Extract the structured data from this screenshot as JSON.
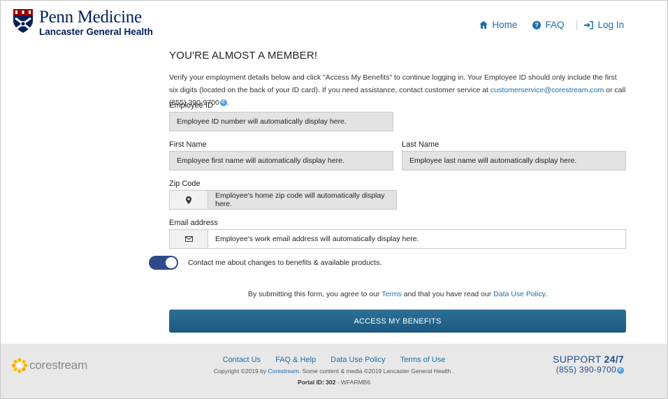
{
  "header": {
    "logo_title": "Penn Medicine",
    "logo_subtitle": "Lancaster General Health",
    "nav": {
      "home": "Home",
      "faq": "FAQ",
      "login": "Log In"
    }
  },
  "main": {
    "title": "YOU'RE ALMOST A MEMBER!",
    "intro_part1": "Verify your employment details below and click \"Access My Benefits\" to continue logging in. Your Employee ID should only include the first six digits (located on the back of your ID card). If you need assistance, contact customer service at ",
    "support_email": "customerservice@corestream.com",
    "intro_part2": " or call (855) 390-9700",
    "intro_end": ".",
    "employee_id": {
      "label": "Employee ID",
      "value": "Employee ID number will automatically display here."
    },
    "first_name": {
      "label": "First Name",
      "value": "Employee first name will automatically display here."
    },
    "last_name": {
      "label": "Last Name",
      "value": "Employee last name will automatically display here."
    },
    "zip": {
      "label": "Zip Code",
      "value": "Employee's home zip code will automatically display here."
    },
    "email": {
      "label": "Email address",
      "value": "Employee's work email address will automatically display here."
    },
    "contact_toggle_label": "Contact me about changes to benefits & available products.",
    "contact_toggle_on": true,
    "terms_part1": "By submitting this form, you agree to our ",
    "terms_link": "Terms",
    "terms_part2": " and that you have read our ",
    "data_use_link": "Data Use Policy",
    "terms_end": ".",
    "submit_label": "ACCESS MY BENEFITS"
  },
  "footer": {
    "logo_text": "corestream",
    "links": [
      "Contact Us",
      "FAQ & Help",
      "Data Use Policy",
      "Terms of Use"
    ],
    "copyright_part1": "Copyright ©2019 by ",
    "copyright_link": "Corestream",
    "copyright_part2": ". Some content & media ©2019 Lancaster General Health .",
    "portal_label": "Portal ID: 302",
    "portal_code": " - WFARMB6",
    "support_prefix": "SUPPORT ",
    "support_hours": "24/7",
    "support_phone": "(855) 390-9700"
  },
  "colors": {
    "brand_navy": "#011f5b",
    "link_blue": "#1a6ea8",
    "button_blue": "#1b5a80",
    "toggle_on": "#2f4a8a",
    "footer_bg": "#e8e8e8"
  },
  "icons": {
    "home": "home-icon",
    "faq": "question-circle-icon",
    "login": "sign-in-icon",
    "zip": "map-marker-icon",
    "email": "envelope-icon",
    "phone": "phone-icon"
  }
}
